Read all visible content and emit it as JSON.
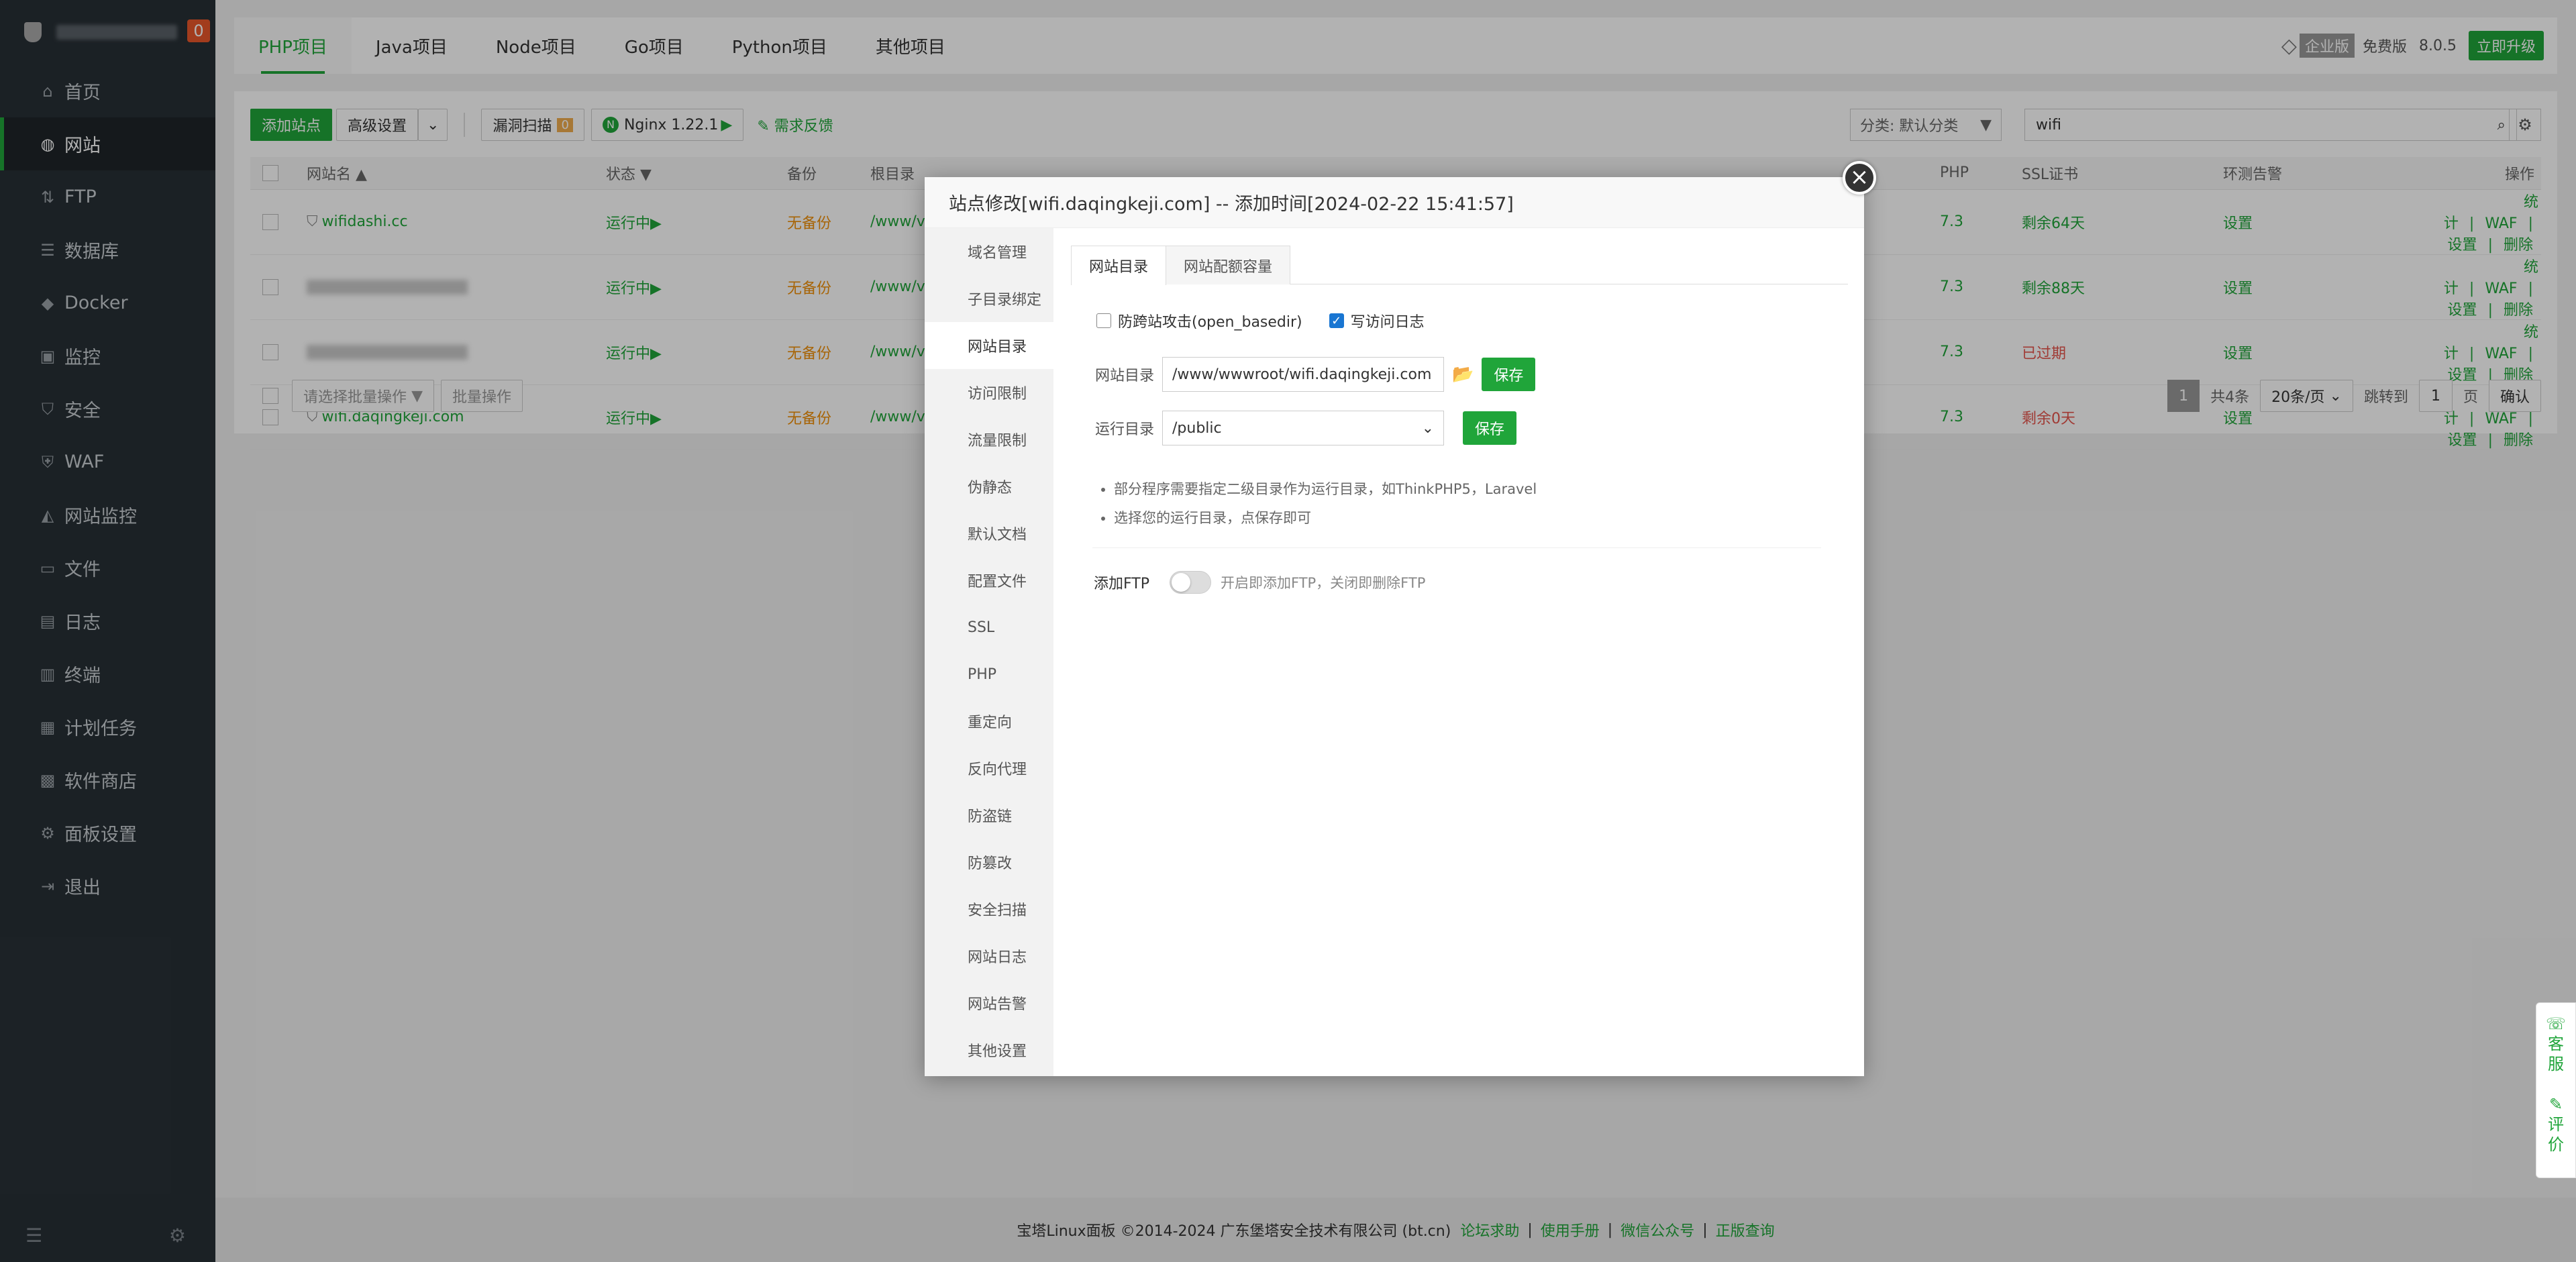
{
  "sidebar": {
    "badge": "0",
    "items": [
      {
        "label": "首页",
        "icon": "home-icon",
        "glyph": "⌂"
      },
      {
        "label": "网站",
        "icon": "globe-icon",
        "glyph": "◍"
      },
      {
        "label": "FTP",
        "icon": "ftp-icon",
        "glyph": "⇅"
      },
      {
        "label": "数据库",
        "icon": "database-icon",
        "glyph": "☰"
      },
      {
        "label": "Docker",
        "icon": "docker-icon",
        "glyph": "◆"
      },
      {
        "label": "监控",
        "icon": "monitor-icon",
        "glyph": "▣"
      },
      {
        "label": "安全",
        "icon": "shield-icon",
        "glyph": "⛉"
      },
      {
        "label": "WAF",
        "icon": "waf-icon",
        "glyph": "⛨"
      },
      {
        "label": "网站监控",
        "icon": "chart-icon",
        "glyph": "◭"
      },
      {
        "label": "文件",
        "icon": "folder-icon",
        "glyph": "▭"
      },
      {
        "label": "日志",
        "icon": "log-icon",
        "glyph": "▤"
      },
      {
        "label": "终端",
        "icon": "terminal-icon",
        "glyph": "▥"
      },
      {
        "label": "计划任务",
        "icon": "calendar-icon",
        "glyph": "▦"
      },
      {
        "label": "软件商店",
        "icon": "store-icon",
        "glyph": "▩"
      },
      {
        "label": "面板设置",
        "icon": "gear-icon",
        "glyph": "⚙"
      },
      {
        "label": "退出",
        "icon": "logout-icon",
        "glyph": "⇥"
      }
    ]
  },
  "project_tabs": [
    "PHP项目",
    "Java项目",
    "Node项目",
    "Go项目",
    "Python项目",
    "其他项目"
  ],
  "topbar": {
    "edition": "企业版",
    "free": "免费版",
    "version": "8.0.5",
    "upgrade": "立即升级"
  },
  "toolbar": {
    "add_site": "添加站点",
    "advanced": "高级设置",
    "vuln_scan": "漏洞扫描",
    "vuln_count": "0",
    "nginx": "Nginx 1.22.1",
    "feedback": "需求反馈",
    "category": "分类: 默认分类",
    "search_value": "wifi"
  },
  "table": {
    "headers": [
      "网站名",
      "状态",
      "备份",
      "根目录",
      "PHP",
      "SSL证书",
      "环测告警",
      "操作"
    ],
    "rows": [
      {
        "name": "wifidashi.cc",
        "status": "运行中▶",
        "backup": "无备份",
        "root": "/www/v",
        "php": "7.3",
        "ssl": "剩余64天",
        "alert": "设置"
      },
      {
        "name": "",
        "status": "运行中▶",
        "backup": "无备份",
        "root": "/www/v",
        "php": "7.3",
        "ssl": "剩余88天",
        "alert": "设置"
      },
      {
        "name": "",
        "status": "运行中▶",
        "backup": "无备份",
        "root": "/www/v",
        "php": "7.3",
        "ssl": "已过期",
        "alert": "设置"
      },
      {
        "name": "wifi.daqingkeji.com",
        "status": "运行中▶",
        "backup": "无备份",
        "root": "/www/v",
        "php": "7.3",
        "ssl": "剩余0天",
        "alert": "设置"
      }
    ],
    "ops": [
      "统计",
      "WAF",
      "设置",
      "删除"
    ],
    "batch_placeholder": "请选择批量操作",
    "batch_btn": "批量操作",
    "page_current": "1",
    "total": "共4条",
    "per_page": "20条/页",
    "jump": "跳转到",
    "jump_value": "1",
    "page_unit": "页",
    "confirm": "确认"
  },
  "modal": {
    "title": "站点修改[wifi.daqingkeji.com] -- 添加时间[2024-02-22 15:41:57]",
    "nav": [
      "域名管理",
      "子目录绑定",
      "网站目录",
      "访问限制",
      "流量限制",
      "伪静态",
      "默认文档",
      "配置文件",
      "SSL",
      "PHP",
      "重定向",
      "反向代理",
      "防盗链",
      "防篡改",
      "安全扫描",
      "网站日志",
      "网站告警",
      "其他设置"
    ],
    "tabs": [
      "网站目录",
      "网站配额容量"
    ],
    "opt_basedir": "防跨站攻击(open_basedir)",
    "opt_log": "写访问日志",
    "site_dir_label": "网站目录",
    "site_dir_value": "/www/wwwroot/wifi.daqingkeji.com",
    "save": "保存",
    "run_dir_label": "运行目录",
    "run_dir_value": "/public",
    "tips": [
      "部分程序需要指定二级目录作为运行目录，如ThinkPHP5，Laravel",
      "选择您的运行目录，点保存即可"
    ],
    "ftp_label": "添加FTP",
    "ftp_tip": "开启即添加FTP，关闭即删除FTP"
  },
  "footer": {
    "copyright": "宝塔Linux面板 ©2014-2024 广东堡塔安全技术有限公司 (bt.cn)",
    "links": [
      "论坛求助",
      "使用手册",
      "微信公众号",
      "正版查询"
    ]
  },
  "rightdock": {
    "service": "客服",
    "review": "评价"
  }
}
